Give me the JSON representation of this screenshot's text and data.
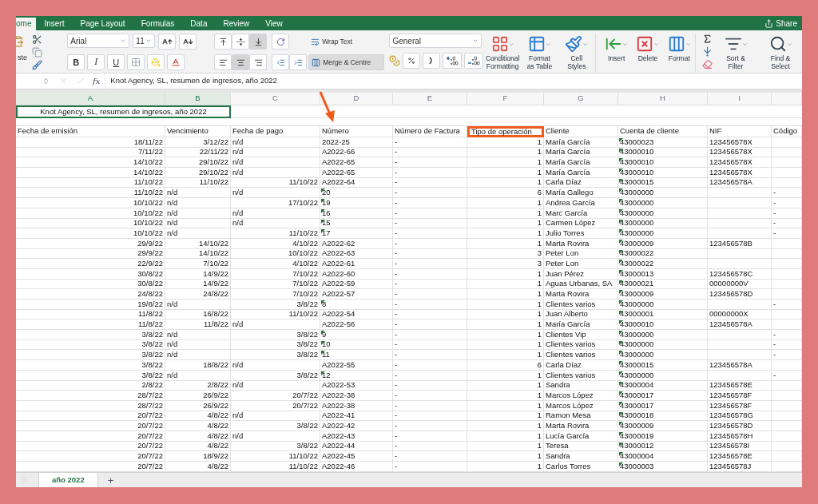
{
  "ribbon_tabs": [
    {
      "label": "ome",
      "selected": true
    },
    {
      "label": "Insert",
      "selected": false
    },
    {
      "label": "Page Layout",
      "selected": false
    },
    {
      "label": "Formulas",
      "selected": false
    },
    {
      "label": "Data",
      "selected": false
    },
    {
      "label": "Review",
      "selected": false
    },
    {
      "label": "View",
      "selected": false
    }
  ],
  "share": "Share",
  "ribbon": {
    "paste_label": "ste",
    "font": "Arial",
    "font_size": "11",
    "bold": "B",
    "italic": "I",
    "underline": "U",
    "vertical_align": [
      {
        "kind": "top",
        "selected": false
      },
      {
        "kind": "middle",
        "selected": false
      },
      {
        "kind": "bottom",
        "selected": true
      }
    ],
    "horizontal_align": [
      {
        "kind": "left",
        "selected": false
      },
      {
        "kind": "center",
        "selected": true
      },
      {
        "kind": "right",
        "selected": false
      }
    ],
    "wrap_text": {
      "label": "Wrap Text",
      "selected": false
    },
    "merge": {
      "label": "Merge & Centre",
      "selected": true
    },
    "number_format": "General",
    "big_buttons": [
      {
        "kind": "conditional",
        "lines": [
          "Conditional",
          "Formatting"
        ]
      },
      {
        "kind": "table",
        "lines": [
          "Format",
          "as Table"
        ]
      },
      {
        "kind": "styles",
        "lines": [
          "Cell",
          "Styles"
        ]
      },
      {
        "kind": "insert",
        "lines": [
          "Insert"
        ]
      },
      {
        "kind": "delete",
        "lines": [
          "Delete"
        ]
      },
      {
        "kind": "format",
        "lines": [
          "Format"
        ]
      },
      {
        "kind": "sort",
        "lines": [
          "Sort &",
          "Filter"
        ]
      },
      {
        "kind": "find",
        "lines": [
          "Find &",
          "Select"
        ]
      }
    ]
  },
  "formula_bar": {
    "fx": "fx",
    "content": "Knot Agency, SL, resumen de ingresos, año 2022"
  },
  "columns": [
    {
      "letter": "A",
      "selected": true
    },
    {
      "letter": "B",
      "selected": true
    },
    {
      "letter": "C",
      "selected": false
    },
    {
      "letter": "D",
      "selected": false
    },
    {
      "letter": "E",
      "selected": false
    },
    {
      "letter": "F",
      "selected": false
    },
    {
      "letter": "G",
      "selected": false
    },
    {
      "letter": "H",
      "selected": false,
      "flagged": true
    },
    {
      "letter": "I",
      "selected": false
    },
    {
      "selected": false
    }
  ],
  "title": "Knot Agency, SL, resumen de ingresos, año 2022",
  "headers": [
    {
      "label": "Fecha de emisión",
      "highlighted": false
    },
    {
      "label": "Vencimiento",
      "highlighted": false
    },
    {
      "label": "Fecha de pago",
      "highlighted": false
    },
    {
      "label": "Número",
      "highlighted": false
    },
    {
      "label": "Número de Factura",
      "highlighted": false
    },
    {
      "label": "Tipo de operación",
      "highlighted": true
    },
    {
      "label": "Cliente",
      "highlighted": false
    },
    {
      "label": "Cuenta de cliente",
      "highlighted": false
    },
    {
      "label": "NIF",
      "highlighted": false
    },
    {
      "label": "Código",
      "highlighted": false
    }
  ],
  "rows": [
    {
      "emision": "18/11/22",
      "vencimiento": {
        "v": "3/12/22",
        "kind": "date"
      },
      "pago": {
        "v": "n/d",
        "kind": "text"
      },
      "numero": "2022-25",
      "numero_flag": false,
      "factura": "-",
      "tipo": "1",
      "cliente": "María García",
      "cuenta": "43000023",
      "nif": "123456578X"
    },
    {
      "emision": "7/11/22",
      "vencimiento": {
        "v": "22/11/22",
        "kind": "date"
      },
      "pago": {
        "v": "n/d",
        "kind": "text"
      },
      "numero": "A2022-66",
      "numero_flag": false,
      "factura": "-",
      "tipo": "1",
      "cliente": "María García",
      "cuenta": "43000010",
      "nif": "123456578X"
    },
    {
      "emision": "14/10/22",
      "vencimiento": {
        "v": "29/10/22",
        "kind": "date"
      },
      "pago": {
        "v": "n/d",
        "kind": "text"
      },
      "numero": "A2022-65",
      "numero_flag": false,
      "factura": "-",
      "tipo": "1",
      "cliente": "María García",
      "cuenta": "43000010",
      "nif": "123456578X"
    },
    {
      "emision": "14/10/22",
      "vencimiento": {
        "v": "29/10/22",
        "kind": "date"
      },
      "pago": {
        "v": "n/d",
        "kind": "text"
      },
      "numero": "A2022-65",
      "numero_flag": false,
      "factura": "-",
      "tipo": "1",
      "cliente": "María García",
      "cuenta": "43000010",
      "nif": "123456578X"
    },
    {
      "emision": "11/10/22",
      "vencimiento": {
        "v": "11/10/22",
        "kind": "date"
      },
      "pago": {
        "v": "11/10/22",
        "kind": "date"
      },
      "numero": "A2022-64",
      "numero_flag": false,
      "factura": "-",
      "tipo": "1",
      "cliente": "Carla Díaz",
      "cuenta": "43000015",
      "nif": "123456578A"
    },
    {
      "emision": "11/10/22",
      "vencimiento": {
        "v": "n/d",
        "kind": "text"
      },
      "pago": {
        "v": "n/d",
        "kind": "text"
      },
      "numero": "20",
      "numero_flag": true,
      "factura": "-",
      "tipo": "6",
      "cliente": "María Gallego",
      "cuenta": "43000000",
      "codigo": "-"
    },
    {
      "emision": "10/10/22",
      "vencimiento": {
        "v": "n/d",
        "kind": "text"
      },
      "pago": {
        "v": "17/10/22",
        "kind": "date"
      },
      "numero": "19",
      "numero_flag": true,
      "factura": "-",
      "tipo": "1",
      "cliente": "Andrea García",
      "cuenta": "43000000",
      "codigo": "-"
    },
    {
      "emision": "10/10/22",
      "vencimiento": {
        "v": "n/d",
        "kind": "text"
      },
      "pago": {
        "v": "n/d",
        "kind": "text"
      },
      "numero": "16",
      "numero_flag": true,
      "factura": "-",
      "tipo": "1",
      "cliente": "Marc García",
      "cuenta": "43000000",
      "codigo": "-"
    },
    {
      "emision": "10/10/22",
      "vencimiento": {
        "v": "n/d",
        "kind": "text"
      },
      "pago": {
        "v": "n/d",
        "kind": "text"
      },
      "numero": "15",
      "numero_flag": true,
      "factura": "-",
      "tipo": "1",
      "cliente": "Carmen López",
      "cuenta": "43000000",
      "codigo": "-"
    },
    {
      "emision": "10/10/22",
      "vencimiento": {
        "v": "n/d",
        "kind": "text"
      },
      "pago": {
        "v": "11/10/22",
        "kind": "date"
      },
      "numero": "17",
      "numero_flag": true,
      "factura": "-",
      "tipo": "1",
      "cliente": "Julio Torres",
      "cuenta": "43000000",
      "codigo": "-"
    },
    {
      "emision": "29/9/22",
      "vencimiento": {
        "v": "14/10/22",
        "kind": "date"
      },
      "pago": {
        "v": "4/10/22",
        "kind": "date"
      },
      "numero": "A2022-62",
      "numero_flag": false,
      "factura": "-",
      "tipo": "1",
      "cliente": "Marta Rovira",
      "cuenta": "43000009",
      "nif": "123456578B"
    },
    {
      "emision": "29/9/22",
      "vencimiento": {
        "v": "14/10/22",
        "kind": "date"
      },
      "pago": {
        "v": "10/10/22",
        "kind": "date"
      },
      "numero": "A2022-63",
      "numero_flag": false,
      "factura": "-",
      "tipo": "3",
      "cliente": "Peter Lon",
      "cuenta": "43000022"
    },
    {
      "emision": "22/9/22",
      "vencimiento": {
        "v": "7/10/22",
        "kind": "date"
      },
      "pago": {
        "v": "4/10/22",
        "kind": "date"
      },
      "numero": "A2022-61",
      "numero_flag": false,
      "factura": "-",
      "tipo": "3",
      "cliente": "Peter Lon",
      "cuenta": "43000022"
    },
    {
      "emision": "30/8/22",
      "vencimiento": {
        "v": "14/9/22",
        "kind": "date"
      },
      "pago": {
        "v": "7/10/22",
        "kind": "date"
      },
      "numero": "A2022-60",
      "numero_flag": false,
      "factura": "-",
      "tipo": "1",
      "cliente": "Juan Pérez",
      "cuenta": "43000013",
      "nif": "123456578C"
    },
    {
      "emision": "30/8/22",
      "vencimiento": {
        "v": "14/9/22",
        "kind": "date"
      },
      "pago": {
        "v": "7/10/22",
        "kind": "date"
      },
      "numero": "A2022-59",
      "numero_flag": false,
      "factura": "-",
      "tipo": "1",
      "cliente": "Aguas Urbanas, SA",
      "cuenta": "43000021",
      "nif": "00000000V"
    },
    {
      "emision": "24/8/22",
      "vencimiento": {
        "v": "24/8/22",
        "kind": "date"
      },
      "pago": {
        "v": "7/10/22",
        "kind": "date"
      },
      "numero": "A2022-57",
      "numero_flag": false,
      "factura": "-",
      "tipo": "1",
      "cliente": "Marta Rovira",
      "cuenta": "43000009",
      "nif": "123456578D"
    },
    {
      "emision": "19/8/22",
      "vencimiento": {
        "v": "n/d",
        "kind": "text"
      },
      "pago": {
        "v": "3/8/22",
        "kind": "date"
      },
      "numero": "8",
      "numero_flag": true,
      "factura": "-",
      "tipo": "1",
      "cliente": "Clientes varios",
      "cuenta": "43000000",
      "codigo": "-"
    },
    {
      "emision": "11/8/22",
      "vencimiento": {
        "v": "16/8/22",
        "kind": "date"
      },
      "pago": {
        "v": "11/10/22",
        "kind": "date"
      },
      "numero": "A2022-54",
      "numero_flag": false,
      "factura": "-",
      "tipo": "1",
      "cliente": "Juan Alberto",
      "cuenta": "43000001",
      "nif": "00000000X"
    },
    {
      "emision": "11/8/22",
      "vencimiento": {
        "v": "11/8/22",
        "kind": "date"
      },
      "pago": {
        "v": "n/d",
        "kind": "text"
      },
      "numero": "A2022-56",
      "numero_flag": false,
      "factura": "-",
      "tipo": "1",
      "cliente": "María García",
      "cuenta": "43000010",
      "nif": "123456578A"
    },
    {
      "emision": "3/8/22",
      "vencimiento": {
        "v": "n/d",
        "kind": "text"
      },
      "pago": {
        "v": "3/8/22",
        "kind": "date"
      },
      "numero": "9",
      "numero_flag": true,
      "factura": "-",
      "tipo": "1",
      "cliente": "Clientes Vip",
      "cuenta": "43000000",
      "codigo": "-"
    },
    {
      "emision": "3/8/22",
      "vencimiento": {
        "v": "n/d",
        "kind": "text"
      },
      "pago": {
        "v": "3/8/22",
        "kind": "date"
      },
      "numero": "10",
      "numero_flag": true,
      "factura": "-",
      "tipo": "1",
      "cliente": "Clientes varios",
      "cuenta": "43000000",
      "codigo": "-"
    },
    {
      "emision": "3/8/22",
      "vencimiento": {
        "v": "n/d",
        "kind": "text"
      },
      "pago": {
        "v": "3/8/22",
        "kind": "date"
      },
      "numero": "11",
      "numero_flag": true,
      "factura": "-",
      "tipo": "1",
      "cliente": "Clientes varios",
      "cuenta": "43000000",
      "codigo": "-"
    },
    {
      "emision": "3/8/22",
      "vencimiento": {
        "v": "18/8/22",
        "kind": "date"
      },
      "pago": {
        "v": "n/d",
        "kind": "text"
      },
      "numero": "A2022-55",
      "numero_flag": false,
      "factura": "-",
      "tipo": "6",
      "cliente": "Carla Díaz",
      "cuenta": "43000015",
      "nif": "123456578A"
    },
    {
      "emision": "3/8/22",
      "vencimiento": {
        "v": "n/d",
        "kind": "text"
      },
      "pago": {
        "v": "3/8/22",
        "kind": "date"
      },
      "numero": "12",
      "numero_flag": true,
      "factura": "-",
      "tipo": "1",
      "cliente": "Clientes varios",
      "cuenta": "43000000",
      "codigo": "-"
    },
    {
      "emision": "2/8/22",
      "vencimiento": {
        "v": "2/8/22",
        "kind": "date"
      },
      "pago": {
        "v": "n/d",
        "kind": "text"
      },
      "numero": "A2022-53",
      "numero_flag": false,
      "factura": "-",
      "tipo": "1",
      "cliente": "Sandra",
      "cuenta": "43000004",
      "nif": "123456578E"
    },
    {
      "emision": "28/7/22",
      "vencimiento": {
        "v": "26/9/22",
        "kind": "date"
      },
      "pago": {
        "v": "20/7/22",
        "kind": "date"
      },
      "numero": "A2022-38",
      "numero_flag": false,
      "factura": "-",
      "tipo": "1",
      "cliente": "Marcos López",
      "cuenta": "43000017",
      "nif": "123456578F"
    },
    {
      "emision": "28/7/22",
      "vencimiento": {
        "v": "26/9/22",
        "kind": "date"
      },
      "pago": {
        "v": "20/7/22",
        "kind": "date"
      },
      "numero": "A2022-38",
      "numero_flag": false,
      "factura": "-",
      "tipo": "1",
      "cliente": "Marcos López",
      "cuenta": "43000017",
      "nif": "123456578F"
    },
    {
      "emision": "20/7/22",
      "vencimiento": {
        "v": "4/8/22",
        "kind": "date"
      },
      "pago": {
        "v": "n/d",
        "kind": "text"
      },
      "numero": "A2022-41",
      "numero_flag": false,
      "factura": "-",
      "tipo": "1",
      "cliente": "Ramon Mesa",
      "cuenta": "43000018",
      "nif": "123456578G"
    },
    {
      "emision": "20/7/22",
      "vencimiento": {
        "v": "4/8/22",
        "kind": "date"
      },
      "pago": {
        "v": "3/8/22",
        "kind": "date"
      },
      "numero": "A2022-42",
      "numero_flag": false,
      "factura": "-",
      "tipo": "1",
      "cliente": "Marta Rovira",
      "cuenta": "43000009",
      "nif": "123456578D"
    },
    {
      "emision": "20/7/22",
      "vencimiento": {
        "v": "4/8/22",
        "kind": "date"
      },
      "pago": {
        "v": "n/d",
        "kind": "text"
      },
      "numero": "A2022-43",
      "numero_flag": false,
      "factura": "-",
      "tipo": "1",
      "cliente": "Lucía García",
      "cuenta": "43000019",
      "nif": "123456578H"
    },
    {
      "emision": "20/7/22",
      "vencimiento": {
        "v": "4/8/22",
        "kind": "date"
      },
      "pago": {
        "v": "3/8/22",
        "kind": "date"
      },
      "numero": "A2022-44",
      "numero_flag": false,
      "factura": "-",
      "tipo": "1",
      "cliente": "Teresa",
      "cuenta": "43000012",
      "nif": "123456578I"
    },
    {
      "emision": "20/7/22",
      "vencimiento": {
        "v": "18/9/22",
        "kind": "date"
      },
      "pago": {
        "v": "11/10/22",
        "kind": "date"
      },
      "numero": "A2022-45",
      "numero_flag": false,
      "factura": "-",
      "tipo": "1",
      "cliente": "Sandra",
      "cuenta": "43000004",
      "nif": "123456578E"
    },
    {
      "emision": "20/7/22",
      "vencimiento": {
        "v": "4/8/22",
        "kind": "date"
      },
      "pago": {
        "v": "11/10/22",
        "kind": "date"
      },
      "numero": "A2022-46",
      "numero_flag": false,
      "factura": "-",
      "tipo": "1",
      "cliente": "Carlos Torres",
      "cuenta": "43000003",
      "nif": "123456578J"
    }
  ],
  "sheet_tabs": [
    {
      "label": "año 2022",
      "selected": true
    }
  ],
  "add_sheet": "+"
}
